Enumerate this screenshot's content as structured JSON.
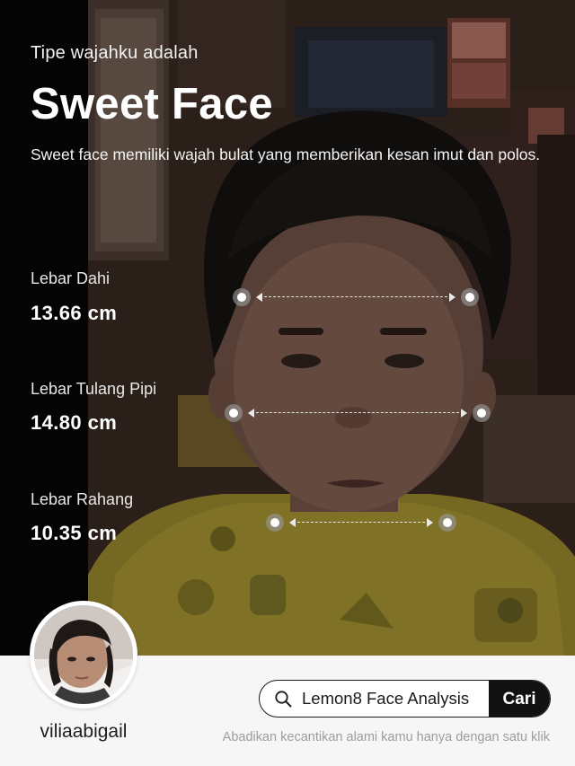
{
  "header": {
    "intro": "Tipe wajahku adalah",
    "title": "Sweet Face",
    "description": "Sweet face memiliki wajah bulat yang memberikan kesan imut dan polos."
  },
  "metrics": [
    {
      "label": "Lebar Dahi",
      "value": "13.66 cm"
    },
    {
      "label": "Lebar Tulang Pipi",
      "value": "14.80 cm"
    },
    {
      "label": "Lebar Rahang",
      "value": "10.35 cm"
    }
  ],
  "profile": {
    "username": "viliaabigail"
  },
  "search": {
    "query": "Lemon8 Face Analysis",
    "button_label": "Cari"
  },
  "footer": {
    "tagline": "Abadikan kecantikan alami kamu hanya dengan satu klik"
  },
  "colors": {
    "shirt": "#d8c23a",
    "button": "#111111"
  },
  "icons": {
    "search": "search-icon"
  }
}
